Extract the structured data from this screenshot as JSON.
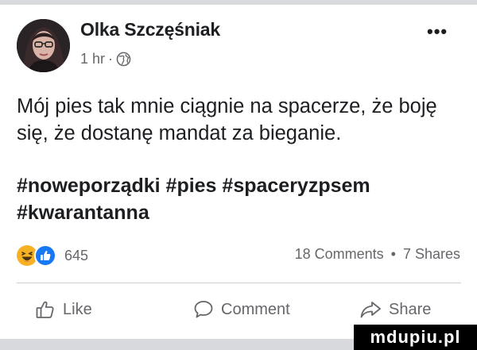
{
  "post": {
    "author": "Olka Szczęśniak",
    "time": "1 hr",
    "separator": "·",
    "privacy_icon": "globe-icon",
    "more_label": "•••",
    "text": "Mój pies tak mnie ciągnie na spacerze, że boję się, że dostanę mandat za bieganie.",
    "hashtags": "#noweporządki #pies #spaceryzpsem #kwarantanna"
  },
  "reactions": {
    "icons": [
      "haha-reaction-icon",
      "like-reaction-icon"
    ],
    "count": "645",
    "comments": "18 Comments",
    "dot": "•",
    "shares": "7 Shares"
  },
  "actions": {
    "like": "Like",
    "comment": "Comment",
    "share": "Share"
  },
  "watermark": "mdupiu.pl",
  "colors": {
    "text": "#1c1e21",
    "secondary": "#65676b",
    "like_blue": "#1877f2",
    "haha_yellow": "#f7b125",
    "divider": "#ced0d4"
  }
}
